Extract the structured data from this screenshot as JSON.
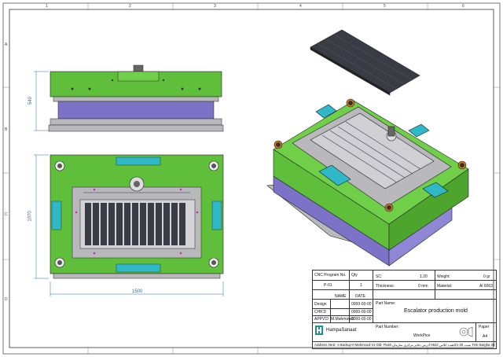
{
  "zones": {
    "columns": [
      "1",
      "2",
      "3",
      "4",
      "5",
      "6"
    ],
    "rows": [
      "A",
      "B",
      "C",
      "D"
    ]
  },
  "dimensions": {
    "height_front": "540",
    "height_top": "1070",
    "width_top": "1500"
  },
  "title_block": {
    "cnc_program_label": "CNC Program No.",
    "cnc_program_value": "P-01",
    "qty_label": "Qty",
    "qty_value": "1",
    "sc_label": "SC:",
    "sc_value": "1:20",
    "weight_label": "Weight:",
    "weight_value": "0 gr",
    "thickness_label": "Thickness:",
    "thickness_value": "0 mm",
    "material_label": "Material:",
    "material_value": "Al 6063",
    "name_label": "NAME",
    "date_label": "DATE",
    "design_label": "Design",
    "design_date": "0000-00-00",
    "chkd_label": "CHK'D",
    "chkd_date": "0000-00-00",
    "appvd_label": "APPV'D",
    "appvd_name": "M.Mahmoudi",
    "appvd_date": "0000-00-00",
    "part_name_label": "Part Name:",
    "part_name_value": "Escalator production mold",
    "part_number_label": "Part Number:",
    "part_number_value": "WorkPice",
    "company": "HampaSanaat",
    "paper_label": "Paper",
    "paper_value": "A4",
    "address_label": "Address Ne.",
    "address_value": "E -4 Backup-0-Mahmoodi 01-Old- Flash تست 25-1کاهنده کلاس 0642-آدرس دفاتر مرکزی سازمان Fele Bargha 30442"
  },
  "colors": {
    "plate_green": "#5fbf3a",
    "plate_grey": "#b9b9bd",
    "insert_purple": "#7c73c9",
    "cavity_dark": "#3a3c45",
    "cyan_block": "#2fb9c8",
    "dimension_blue": "#1e6fb5"
  }
}
